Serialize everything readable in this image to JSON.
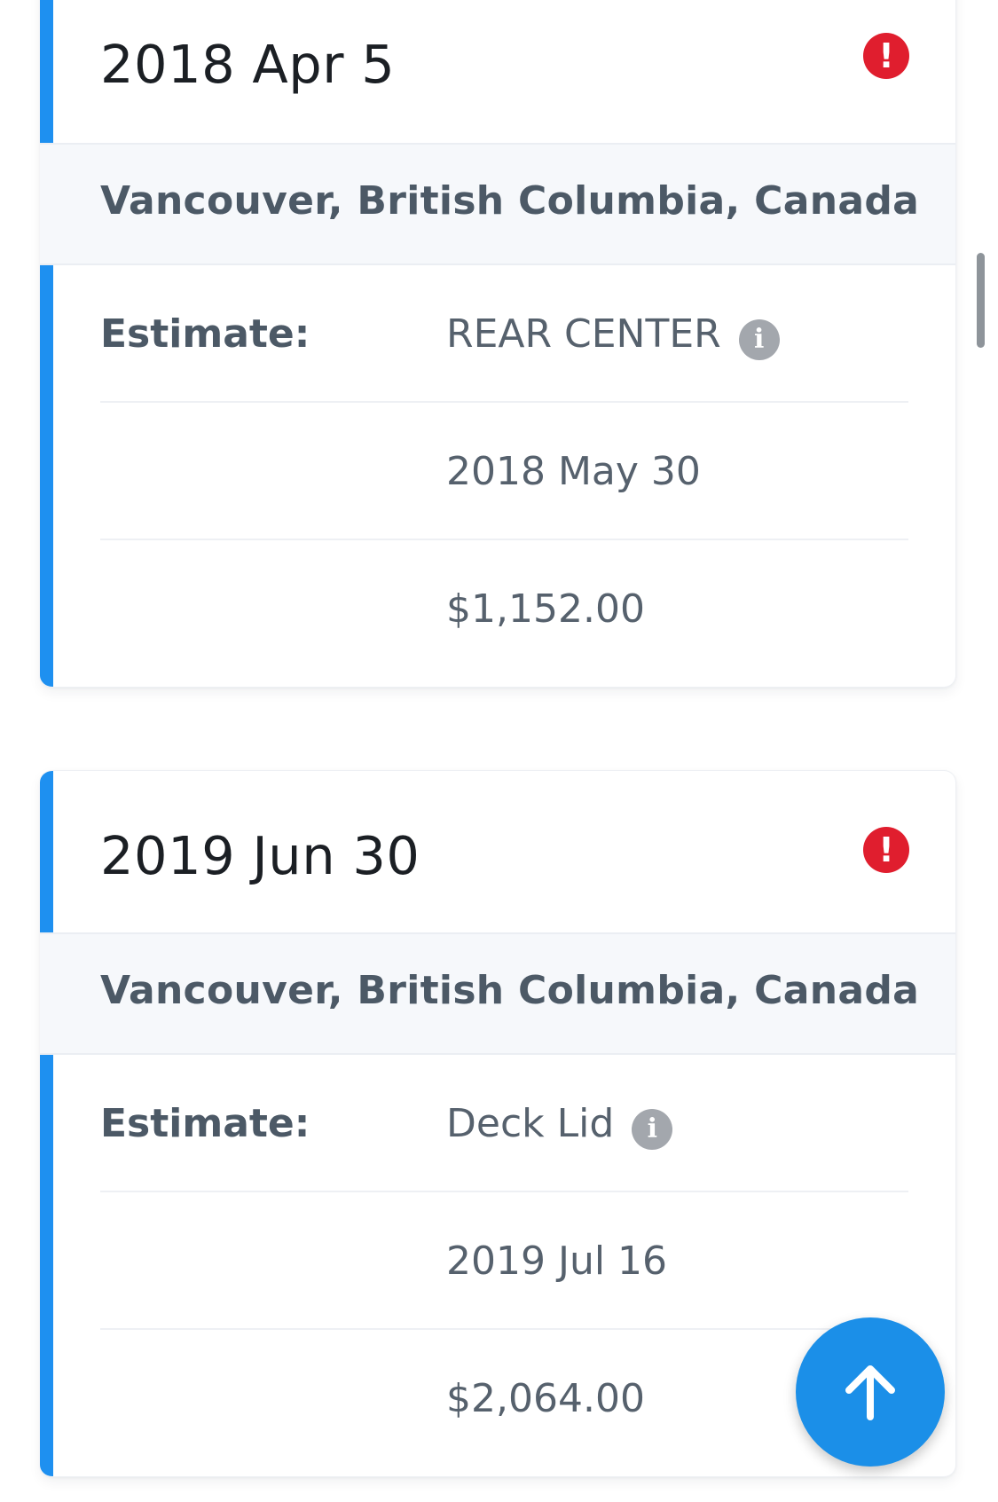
{
  "cards": [
    {
      "date": "2018 Apr 5",
      "alert_icon": "exclamation-circle-icon",
      "location": "Vancouver, British Columbia, Canada",
      "estimate_label": "Estimate:",
      "estimate_name": "REAR CENTER",
      "estimate_date": "2018 May 30",
      "estimate_amount": "$1,152.00"
    },
    {
      "date": "2019 Jun 30",
      "alert_icon": "exclamation-circle-icon",
      "location": "Vancouver, British Columbia, Canada",
      "estimate_label": "Estimate:",
      "estimate_name": "Deck Lid",
      "estimate_date": "2019 Jul 16",
      "estimate_amount": "$2,064.00"
    }
  ],
  "icons": {
    "alert_glyph": "!",
    "info_glyph": "i",
    "fab_icon": "arrow-up-icon"
  },
  "colors": {
    "accent": "#1e90f0",
    "alert": "#e01e2e",
    "fab": "#1b8fe8"
  }
}
